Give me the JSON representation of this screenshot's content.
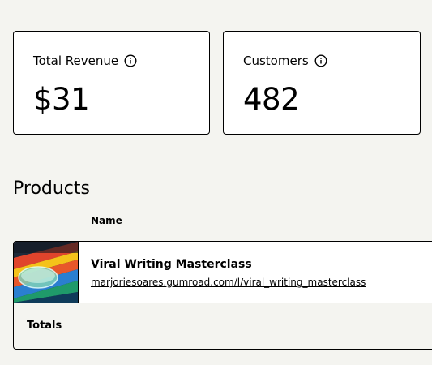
{
  "stats": {
    "revenue": {
      "label": "Total Revenue",
      "value": "$31",
      "icon": "info-icon"
    },
    "customers": {
      "label": "Customers",
      "value": "482",
      "icon": "info-icon"
    }
  },
  "products": {
    "title": "Products",
    "columns": [
      "Name"
    ],
    "rows": [
      {
        "name": "Viral Writing Masterclass",
        "url": "marjoriesoares.gumroad.com/l/viral_writing_masterclass"
      }
    ],
    "totals_label": "Totals"
  }
}
